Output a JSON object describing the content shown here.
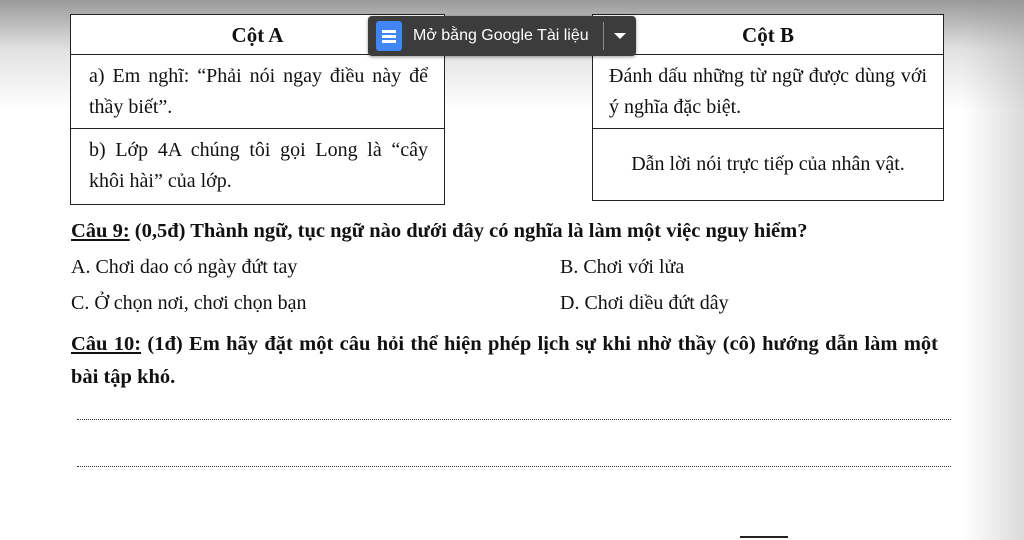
{
  "overlay": {
    "open_label": "Mở bằng Google Tài liệu",
    "icon": "google-docs-icon",
    "dropdown_icon": "caret-down-icon",
    "colors": {
      "bar": "#3c3c3c",
      "icon": "#4285f4"
    }
  },
  "table": {
    "col_a": {
      "header": "Cột A",
      "rows": [
        "a) Em nghĩ: “Phải nói ngay điều này để thầy biết”.",
        "b) Lớp 4A chúng tôi gọi Long là “cây khôi hài” của lớp."
      ]
    },
    "col_b": {
      "header": "Cột B",
      "rows": [
        "Đánh dấu những từ ngữ được dùng với ý nghĩa đặc biệt.",
        "Dẫn lời nói trực tiếp của nhân vật."
      ]
    }
  },
  "q9": {
    "label": "Câu 9:",
    "text": " (0,5đ) Thành ngữ, tục ngữ nào dưới đây có nghĩa là làm một việc nguy hiểm?",
    "options": [
      "A. Chơi dao có ngày đứt tay",
      "B. Chơi với lửa",
      "C. Ở chọn nơi, chơi chọn bạn",
      "D. Chơi diều đứt dây"
    ]
  },
  "q10": {
    "label": "Câu 10:",
    "text": " (1đ) Em hãy đặt một câu hỏi thể hiện phép lịch sự khi nhờ thầy (cô) hướng dẫn làm một bài tập khó."
  }
}
